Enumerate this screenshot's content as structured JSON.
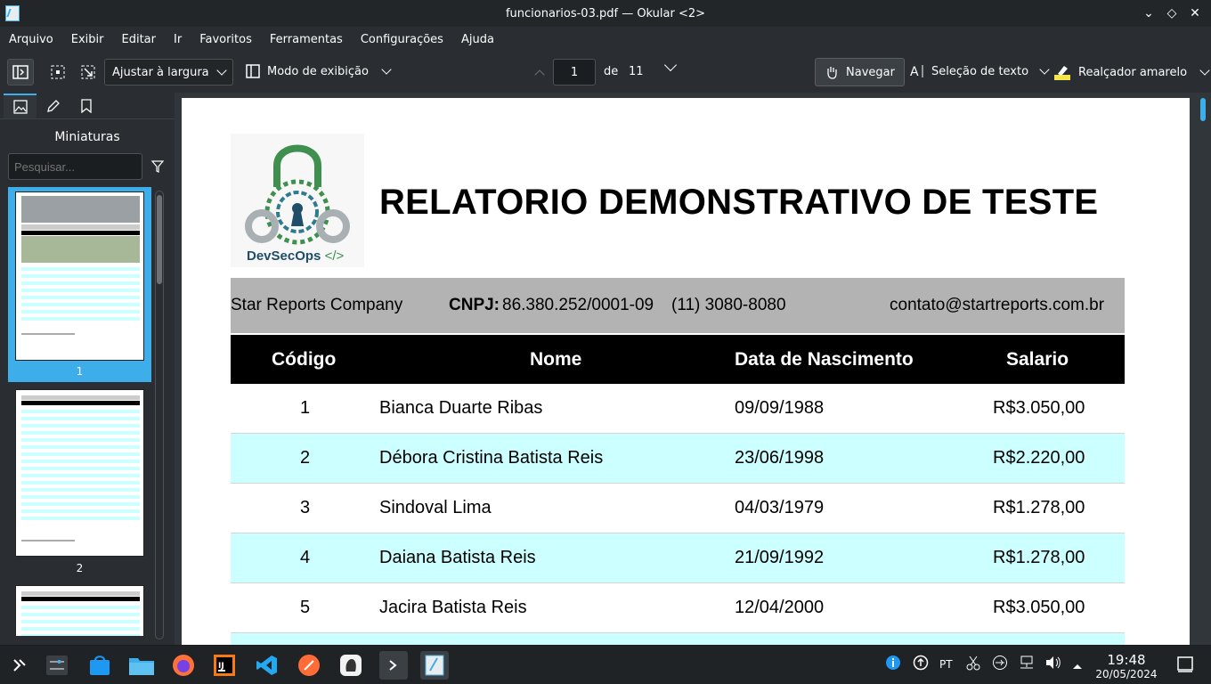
{
  "window": {
    "title": "funcionarios-03.pdf — Okular <2>"
  },
  "menu": [
    "Arquivo",
    "Exibir",
    "Editar",
    "Ir",
    "Favoritos",
    "Ferramentas",
    "Configurações",
    "Ajuda"
  ],
  "toolbar": {
    "zoom_value": "Ajustar à largura",
    "view_mode_label": "Modo de exibição",
    "page_current": "1",
    "page_of_label": "de",
    "page_total": "11",
    "navigate_label": "Navegar",
    "text_select_label": "Seleção de texto",
    "highlighter_label": "Realçador amarelo"
  },
  "sidebar": {
    "title": "Miniaturas",
    "search_placeholder": "Pesquisar...",
    "thumbnails": [
      {
        "number": "1",
        "selected": true
      },
      {
        "number": "2",
        "selected": false
      }
    ]
  },
  "document": {
    "logo_text": "DevSecOps",
    "logo_code": "</>",
    "title": "RELATORIO DEMONSTRATIVO DE TESTE",
    "company_name": "Star Reports Company",
    "cnpj_label": "CNPJ:",
    "cnpj_value": "86.380.252/0001-09",
    "phone": "(11) 3080-8080",
    "email": "contato@startreports.com.br",
    "columns": [
      "Código",
      "Nome",
      "Data de Nascimento",
      "Salario"
    ],
    "rows": [
      {
        "code": "1",
        "name": "Bianca Duarte Ribas",
        "birth": "09/09/1988",
        "salary": "R$3.050,00"
      },
      {
        "code": "2",
        "name": "Débora Cristina Batista Reis",
        "birth": "23/06/1998",
        "salary": "R$2.220,00"
      },
      {
        "code": "3",
        "name": "Sindoval Lima",
        "birth": "04/03/1979",
        "salary": "R$1.278,00"
      },
      {
        "code": "4",
        "name": "Daiana Batista Reis",
        "birth": "21/09/1992",
        "salary": "R$1.278,00"
      },
      {
        "code": "5",
        "name": "Jacira Batista Reis",
        "birth": "12/04/2000",
        "salary": "R$3.050,00"
      }
    ]
  },
  "taskbar": {
    "language": "PT",
    "time": "19:48",
    "date": "20/05/2024"
  },
  "colors": {
    "accent": "#3daee9",
    "row_alt": "#ccffff",
    "header_bar": "#b3b3b3",
    "logo_green": "#3f8f4f",
    "logo_gray": "#a8b0b3"
  }
}
